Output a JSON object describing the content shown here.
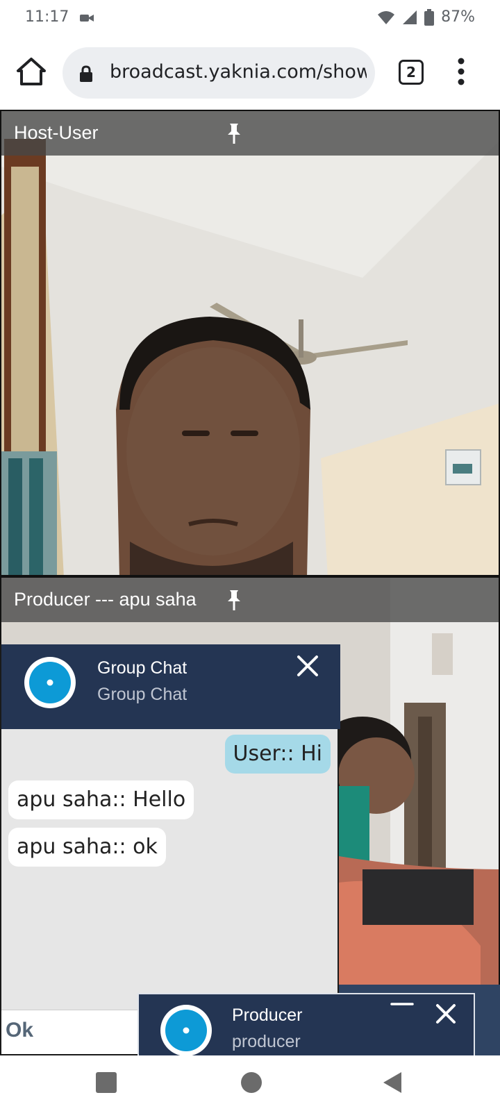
{
  "status_bar": {
    "time": "11:17",
    "battery": "87%",
    "icons": [
      "video-call-icon",
      "wifi-icon",
      "signal-icon",
      "battery-icon"
    ]
  },
  "browser": {
    "url": "broadcast.yaknia.com/show",
    "tab_count": "2",
    "icons": [
      "home-icon",
      "lock-icon",
      "overflow-menu-icon"
    ]
  },
  "videos": {
    "host": {
      "caption": "Host-User"
    },
    "producer": {
      "caption": "Producer --- apu saha"
    }
  },
  "group_chat": {
    "title": "Group Chat",
    "subtitle": "Group Chat",
    "messages": [
      {
        "text": "User:: Hi",
        "direction": "out"
      },
      {
        "text": "apu saha:: Hello",
        "direction": "in"
      },
      {
        "text": "apu saha:: ok",
        "direction": "in"
      }
    ],
    "ok_label": "Ok"
  },
  "producer_chat": {
    "title": "Producer",
    "subtitle": "producer"
  },
  "colors": {
    "chat_header": "#243553",
    "outgoing_bubble": "#a5d9e8",
    "avatar_accent": "#0d9ad6"
  }
}
